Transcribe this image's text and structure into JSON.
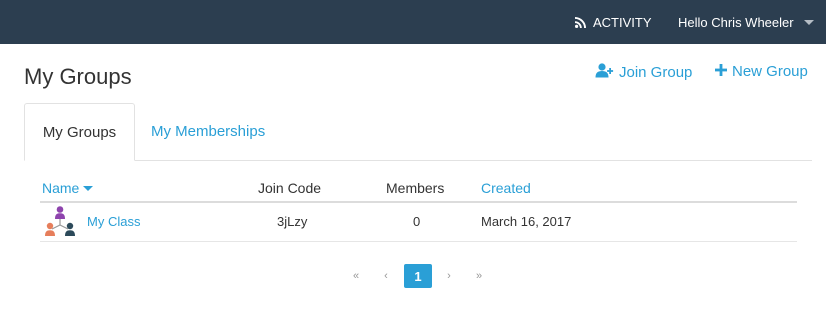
{
  "topbar": {
    "activity_label": "ACTIVITY",
    "user_greeting": "Hello Chris Wheeler"
  },
  "page": {
    "title": "My Groups",
    "join_group_label": "Join Group",
    "new_group_label": "New Group"
  },
  "tabs": [
    {
      "label": "My Groups",
      "active": true
    },
    {
      "label": "My Memberships",
      "active": false
    }
  ],
  "table": {
    "columns": [
      "Name",
      "Join Code",
      "Members",
      "Created"
    ],
    "rows": [
      {
        "name": "My Class",
        "join_code": "3jLzy",
        "members": "0",
        "created": "March 16, 2017"
      }
    ]
  },
  "pagination": {
    "first": "«",
    "prev": "‹",
    "current": "1",
    "next": "›",
    "last": "»"
  },
  "colors": {
    "topbar_bg": "#2c3e50",
    "accent": "#2a9fd6"
  },
  "icons": {
    "activity": "rss-icon",
    "join_group": "user-plus-icon",
    "new_group": "plus-icon",
    "user_menu": "caret-down-icon",
    "group": "group-network-icon"
  }
}
